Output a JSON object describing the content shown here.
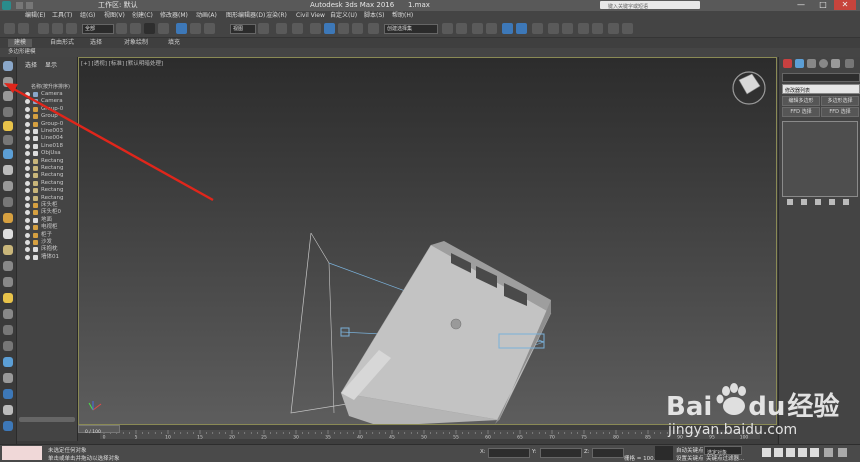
{
  "window": {
    "app_title": "Autodesk 3ds Max 2016",
    "file_name": "1.max",
    "workspace_label": "工作区: 默认",
    "search_placeholder": "键入关键字或短语",
    "controls": [
      "—",
      "□",
      "✕"
    ]
  },
  "menu": [
    "编辑(E)",
    "工具(T)",
    "组(G)",
    "视图(V)",
    "创建(C)",
    "修改器(M)",
    "动画(A)",
    "图形编辑器(D)",
    "渲染(R)",
    "Civil View",
    "自定义(U)",
    "脚本(S)",
    "帮助(H)"
  ],
  "toolbar": {
    "selection_filter": "全部",
    "view_dropdown": "视图",
    "named_set_placeholder": "创建选择集"
  },
  "ribbon": {
    "tabs": [
      "建模",
      "自由形式",
      "选择",
      "对象绘制",
      "填充"
    ],
    "subtitle": "多边形建模"
  },
  "explorer": {
    "tabs": [
      "选择",
      "显示"
    ],
    "header": "名称(按升序排序)",
    "items": [
      "Camera",
      "Camera",
      "Group-0",
      "Group",
      "Group-0",
      "Line003",
      "Line004",
      "Line018",
      "ObjUsa",
      "Rectang",
      "Rectang",
      "Rectang",
      "Rectang",
      "Rectang",
      "Rectang",
      "床头柜",
      "床头柜0",
      "地面",
      "电视柜",
      "柜子",
      "沙发",
      "床抱枕",
      "墙体01"
    ]
  },
  "viewport": {
    "label": "[+] [透视] [标准] [默认明暗处理]"
  },
  "command_panel": {
    "name_field": "",
    "modifier_list": "修改器列表",
    "buttons": [
      "编辑多边形",
      "多边形选择",
      "FFD 选择",
      "FFD 选择"
    ]
  },
  "timeline": {
    "frame_label": "0 / 100",
    "ticks": [
      "0",
      "5",
      "10",
      "15",
      "20",
      "25",
      "30",
      "35",
      "40",
      "45",
      "50",
      "55",
      "60",
      "65",
      "70",
      "75",
      "80",
      "85",
      "90",
      "95",
      "100"
    ]
  },
  "status": {
    "selection_text": "未选定任何对象",
    "prompt_text": "单击或单击并拖动以选择对象",
    "coord_x": "X:",
    "coord_y": "Y:",
    "coord_z": "Z:",
    "grid_text": "栅格 = 100.0",
    "autokey": "自动关键点",
    "selected_object": "选定对象",
    "set_key": "设置关键点",
    "key_filter": "关键点过滤器..."
  },
  "watermark": {
    "brand_latin": "Bai",
    "brand_du": "du",
    "brand_cn": "经验",
    "url": "jingyan.baidu.com"
  },
  "colors": {
    "annotation_arrow": "#e0261b",
    "watermark": "#f2f2f2",
    "viewport_border": "#8a8a55"
  }
}
